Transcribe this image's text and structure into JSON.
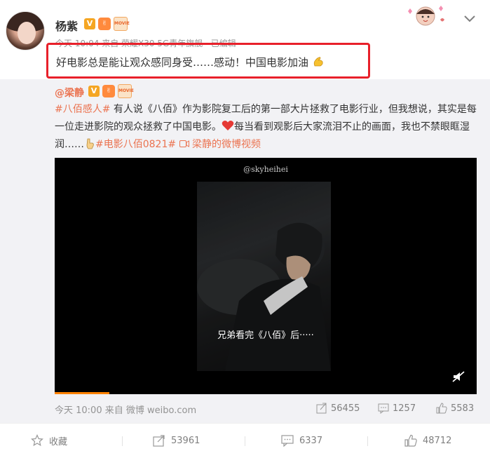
{
  "post": {
    "author_name": "杨紫",
    "verified_badge": "V",
    "medal_badge": "✌",
    "movie_badge": "MOVIE",
    "meta_obscured": "今天 10:04 来自 荣耀X30 5G青年旗舰 · 已编辑",
    "text": "好电影总是能让观众感同身受……感动！中国电影加油",
    "emoji": "muscle-emoji"
  },
  "repost": {
    "author": "@梁静",
    "verified_badge": "V",
    "medal_badge": "✌",
    "movie_badge": "MOVIE",
    "hashtag1": "#八佰感人#",
    "text_part1": " 有人说《八佰》作为影院复工后的第一部大片拯救了电影行业，但我想说，其实是每一位走进影院的观众拯救了中国电影。",
    "text_part2": "每当看到观影后大家流泪不止的画面，我也不禁眼眶湿润……",
    "hashtag2": "#电影八佰0821#",
    "video_link": "梁静的微博视频",
    "video_watermark": "@skyheihei",
    "video_caption": "兄弟看完《八佰》后·····",
    "video_progress": 0.13,
    "time_source": "今天 10:00 来自 微博 weibo.com",
    "reposts": "56455",
    "comments": "1257",
    "likes": "5583"
  },
  "actions": {
    "favorite": "收藏",
    "repost_count": "53961",
    "comment_count": "6337",
    "like_count": "48712"
  },
  "colors": {
    "accent": "#eb7350",
    "highlight_border": "#e8202a",
    "progress": "#ff8200"
  }
}
